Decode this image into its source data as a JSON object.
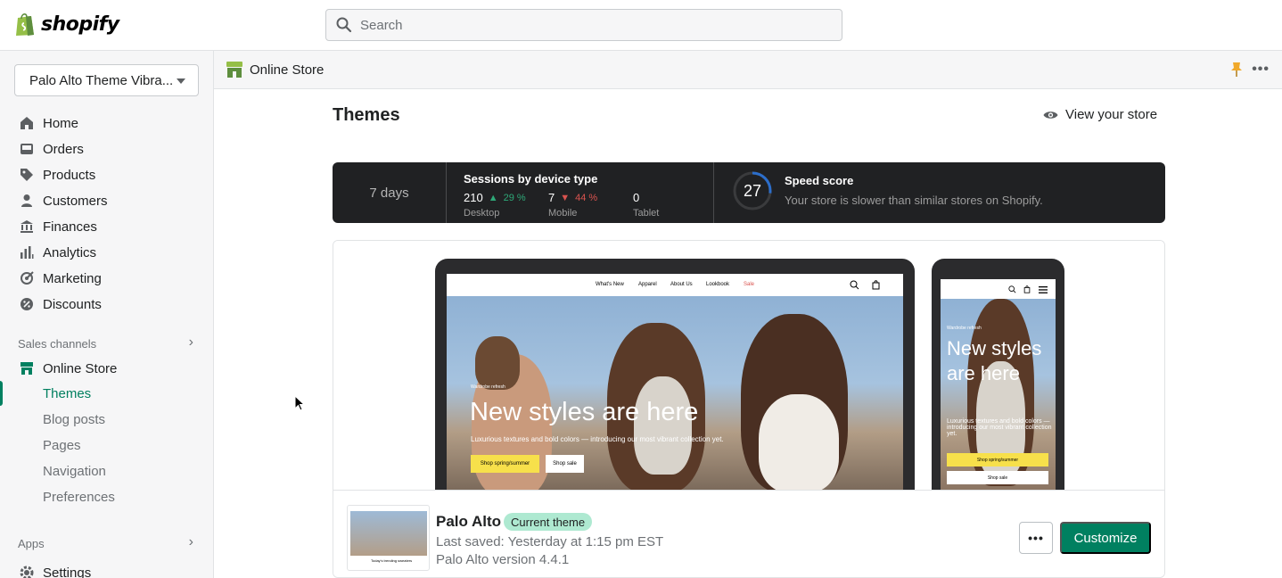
{
  "topbar": {
    "brand": "shopify",
    "search_placeholder": "Search"
  },
  "sidebar": {
    "store_name": "Palo Alto Theme Vibra...",
    "items": [
      {
        "label": "Home",
        "icon": "home-icon"
      },
      {
        "label": "Orders",
        "icon": "orders-icon"
      },
      {
        "label": "Products",
        "icon": "tag-icon"
      },
      {
        "label": "Customers",
        "icon": "person-icon"
      },
      {
        "label": "Finances",
        "icon": "bank-icon"
      },
      {
        "label": "Analytics",
        "icon": "bar-chart-icon"
      },
      {
        "label": "Marketing",
        "icon": "target-icon"
      },
      {
        "label": "Discounts",
        "icon": "discount-icon"
      }
    ],
    "sales_channels_label": "Sales channels",
    "online_store_label": "Online Store",
    "sub_items": [
      {
        "label": "Themes",
        "active": true
      },
      {
        "label": "Blog posts"
      },
      {
        "label": "Pages"
      },
      {
        "label": "Navigation"
      },
      {
        "label": "Preferences"
      }
    ],
    "apps_label": "Apps",
    "settings_label": "Settings"
  },
  "header": {
    "title": "Online Store"
  },
  "page": {
    "title": "Themes",
    "view_store": "View your store"
  },
  "stats": {
    "period": "7 days",
    "sessions_title": "Sessions by device type",
    "desktop": {
      "value": "210",
      "change": "29 %",
      "label": "Desktop"
    },
    "mobile": {
      "value": "7",
      "change": "44 %",
      "label": "Mobile"
    },
    "tablet": {
      "value": "0",
      "label": "Tablet"
    },
    "speed_score": "27",
    "speed_fraction": 0.27,
    "speed_title": "Speed score",
    "speed_desc": "Your store is slower than similar stores on Shopify."
  },
  "preview": {
    "nav": [
      "What's New",
      "Apparel",
      "About Us",
      "Lookbook",
      "Sale"
    ],
    "eyebrow": "Wardrobe refresh",
    "headline": "New styles are here",
    "subline": "Luxurious textures and bold colors — introducing our most vibrant collection yet.",
    "btn_primary": "Shop spring/summer",
    "btn_secondary": "Shop sale",
    "thumb_caption": "Today's trending sweaters"
  },
  "theme": {
    "name": "Palo Alto",
    "badge": "Current theme",
    "saved": "Last saved: Yesterday at 1:15 pm EST",
    "version": "Palo Alto version 4.4.1",
    "more": "•••",
    "customize": "Customize"
  },
  "colors": {
    "accent": "#008060",
    "badge_bg": "#aee9d1",
    "stats_bg": "#202123",
    "up": "#2ea978",
    "down": "#d9534f",
    "speed_ring": "#2c6ecb"
  }
}
